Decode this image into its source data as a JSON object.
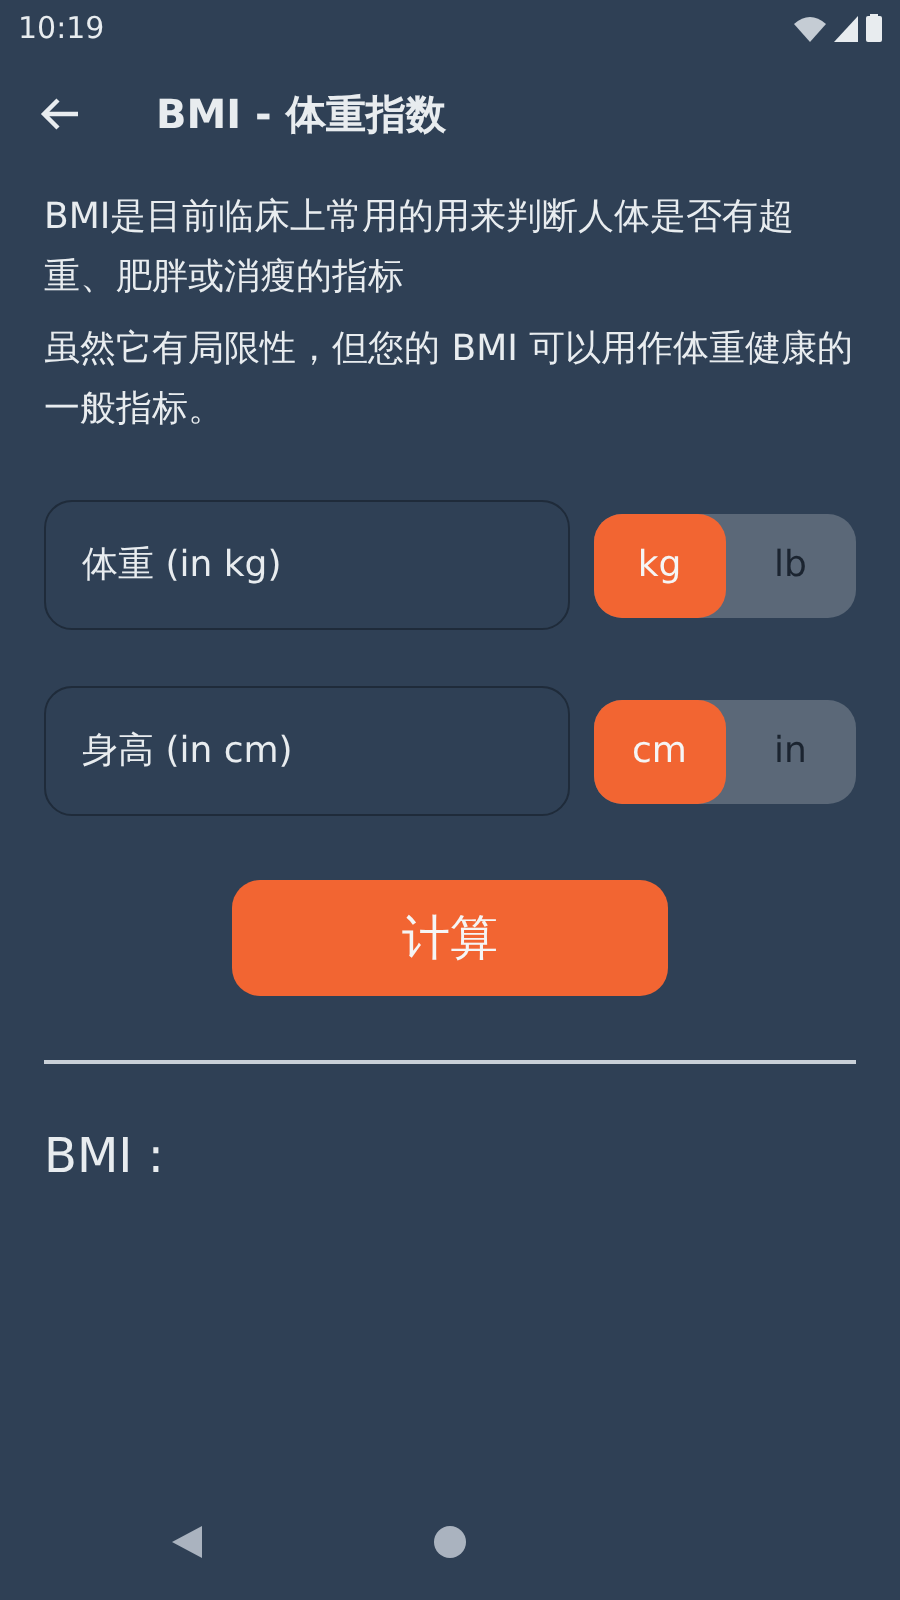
{
  "status_bar": {
    "time": "10:19"
  },
  "app_bar": {
    "title": "BMI - 体重指数"
  },
  "intro": [
    "BMI是目前临床上常用的用来判断人体是否有超重、肥胖或消瘦的指标",
    "虽然它有局限性，但您的 BMI 可以用作体重健康的一般指标。"
  ],
  "inputs": [
    {
      "placeholder": "体重 (in kg)",
      "units": [
        {
          "label": "kg",
          "selected": true
        },
        {
          "label": "lb",
          "selected": false
        }
      ]
    },
    {
      "placeholder": "身高 (in cm)",
      "units": [
        {
          "label": "cm",
          "selected": true
        },
        {
          "label": "in",
          "selected": false
        }
      ]
    }
  ],
  "calculate_button": "计算",
  "result_label": "BMI :"
}
